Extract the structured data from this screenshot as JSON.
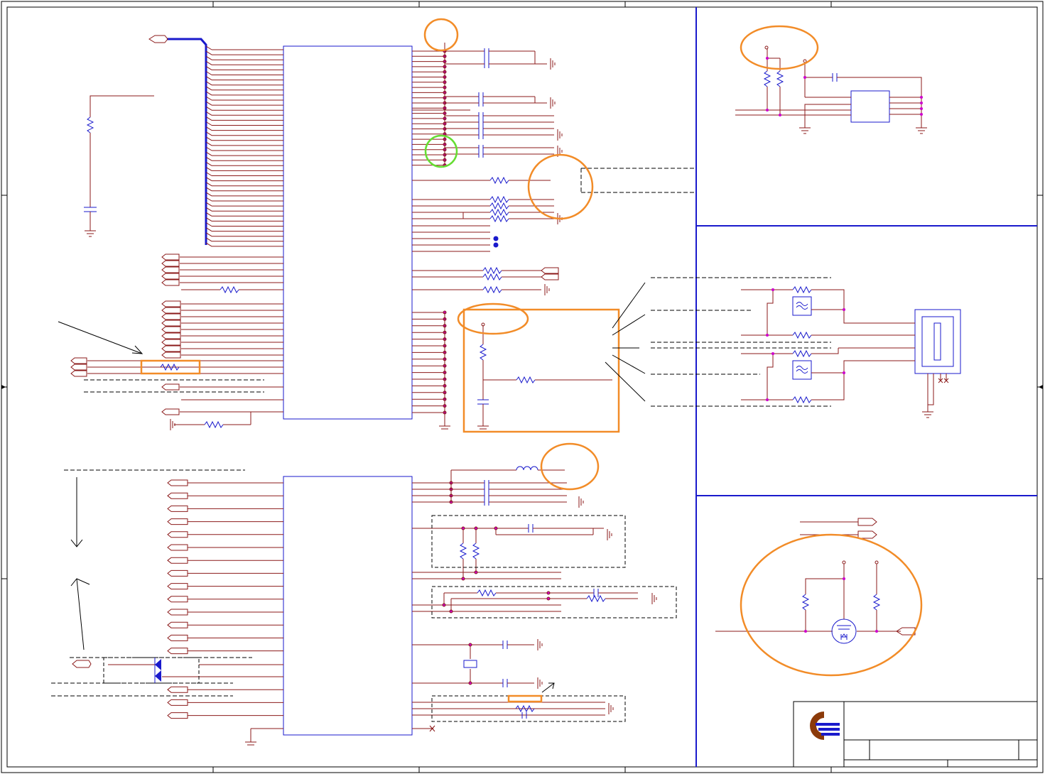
{
  "domain": "Diagram",
  "sheet": {
    "kind": "electronic-schematic",
    "border_color": "#000000",
    "wire_color": "#8b1a1a",
    "bus_color": "#1a1acc",
    "component_color": "#1a1acc",
    "junction_color": "#cc00cc",
    "highlight_color": "#f28c28",
    "highlight_alt_color": "#66dd33"
  },
  "blocks": {
    "ic_top": {
      "type": "ic-body"
    },
    "ic_bottom": {
      "type": "ic-body"
    },
    "ic_right_top": {
      "type": "ic-body"
    },
    "connector": {
      "type": "connector-body"
    },
    "mosfet": {
      "type": "mosfet"
    }
  },
  "title_block": {
    "logo_icon": "company-logo-icon",
    "logo_colors": [
      "#8b3a0a",
      "#1a1acc"
    ]
  },
  "highlights": {
    "circles": 7,
    "rectangles": 3,
    "green_circles": 1
  }
}
